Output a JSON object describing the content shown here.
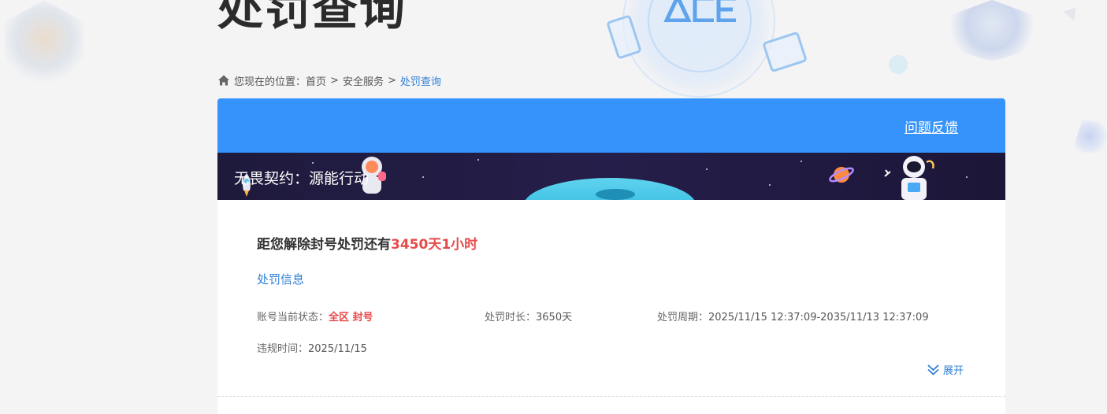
{
  "page": {
    "title": "处罚查询"
  },
  "breadcrumb": {
    "prefix": "您现在的位置：",
    "items": [
      "首页",
      "安全服务",
      "处罚查询"
    ],
    "separator": ">"
  },
  "header": {
    "feedback_label": "问题反馈",
    "accent_color": "#3593fb"
  },
  "banner": {
    "game_title": "无畏契约：源能行动"
  },
  "penalty": {
    "countdown_prefix": "距您解除封号处罚还有",
    "countdown_value": "3450天1小时",
    "section_title": "处罚信息",
    "status_label": "账号当前状态：",
    "status_value": "全区 封号",
    "duration_label": "处罚时长：",
    "duration_value": "3650天",
    "period_label": "处罚周期：",
    "period_value": "2025/11/15 12:37:09-2035/11/13 12:37:09",
    "violation_time_label": "违规时间：",
    "violation_time_value": "2025/11/15",
    "expand_label": "展开",
    "highlight_color": "#e84a4a"
  },
  "icons": {
    "home": "home-icon",
    "expand": "double-chevron-down-icon"
  }
}
